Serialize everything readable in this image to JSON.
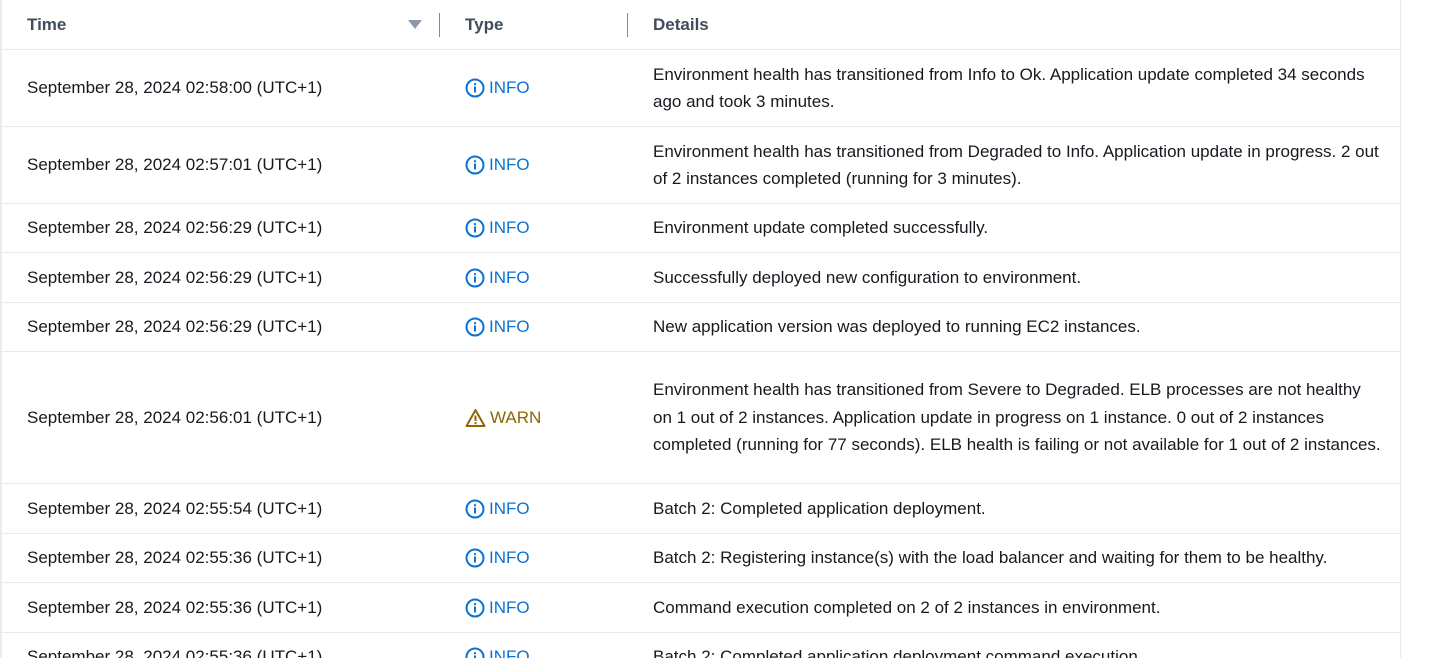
{
  "table": {
    "columns": {
      "time": "Time",
      "type": "Type",
      "details": "Details"
    },
    "rows": [
      {
        "time": "September 28, 2024 02:58:00 (UTC+1)",
        "type": "INFO",
        "icon": "info-icon",
        "details": "Environment health has transitioned from Info to Ok. Application update completed 34 seconds ago and took 3 minutes."
      },
      {
        "time": "September 28, 2024 02:57:01 (UTC+1)",
        "type": "INFO",
        "icon": "info-icon",
        "details": "Environment health has transitioned from Degraded to Info. Application update in progress. 2 out of 2 instances completed (running for 3 minutes)."
      },
      {
        "time": "September 28, 2024 02:56:29 (UTC+1)",
        "type": "INFO",
        "icon": "info-icon",
        "details": "Environment update completed successfully."
      },
      {
        "time": "September 28, 2024 02:56:29 (UTC+1)",
        "type": "INFO",
        "icon": "info-icon",
        "details": "Successfully deployed new configuration to environment."
      },
      {
        "time": "September 28, 2024 02:56:29 (UTC+1)",
        "type": "INFO",
        "icon": "info-icon",
        "details": "New application version was deployed to running EC2 instances."
      },
      {
        "time": "September 28, 2024 02:56:01 (UTC+1)",
        "type": "WARN",
        "icon": "warning-icon",
        "details": "Environment health has transitioned from Severe to Degraded. ELB processes are not healthy on 1 out of 2 instances. Application update in progress on 1 instance. 0 out of 2 instances completed (running for 77 seconds). ELB health is failing or not available for 1 out of 2 instances."
      },
      {
        "time": "September 28, 2024 02:55:54 (UTC+1)",
        "type": "INFO",
        "icon": "info-icon",
        "details": "Batch 2: Completed application deployment."
      },
      {
        "time": "September 28, 2024 02:55:36 (UTC+1)",
        "type": "INFO",
        "icon": "info-icon",
        "details": "Batch 2: Registering instance(s) with the load balancer and waiting for them to be healthy."
      },
      {
        "time": "September 28, 2024 02:55:36 (UTC+1)",
        "type": "INFO",
        "icon": "info-icon",
        "details": "Command execution completed on 2 of 2 instances in environment."
      },
      {
        "time": "September 28, 2024 02:55:36 (UTC+1)",
        "type": "INFO",
        "icon": "info-icon",
        "details": "Batch 2: Completed application deployment command execution."
      }
    ]
  },
  "colors": {
    "info": "#0972d3",
    "warn": "#8d6605",
    "divider": "#e9ebed",
    "header_text": "#414d5c"
  }
}
